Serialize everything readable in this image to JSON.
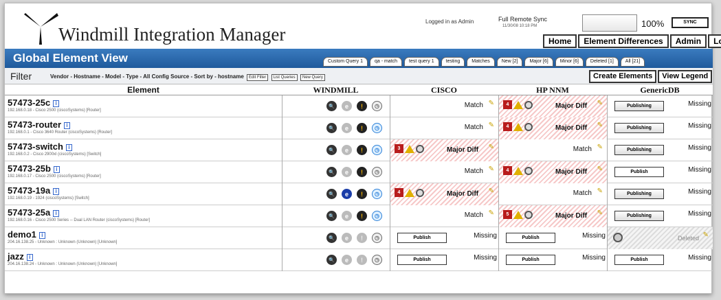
{
  "app": {
    "title": "Windmill Integration Manager"
  },
  "header": {
    "logged_in": "Logged in as Admin",
    "remote_sync": "Full Remote Sync",
    "remote_date": "11/30/08 10:18 PM",
    "percent": "100%",
    "sync_label": "SYNC",
    "nav": [
      "Home",
      "Element Differences",
      "Admin",
      "Logout"
    ]
  },
  "bar": {
    "title": "Global Element View",
    "tabs": [
      "Custom Query 1",
      "qa - match",
      "test query 1",
      "testing",
      "Matches",
      "New [2]",
      "Major [6]",
      "Minor [6]",
      "Deleted [1]",
      "All [21]"
    ]
  },
  "filter": {
    "label": "Filter",
    "text": "Vendor - Hostname - Model - Type - All Config Source - Sort by - hostname",
    "buttons": [
      "Edit Filter",
      "List Queries",
      "New Query"
    ],
    "create": "Create Elements",
    "legend": "View Legend"
  },
  "columns": [
    "Element",
    "WINDMILL",
    "CISCO",
    "HP NNM",
    "GenericDB"
  ],
  "labels": {
    "publish": "Publish",
    "publishing": "Publishing",
    "missing": "Missing",
    "deleted": "Deleted",
    "match": "Match",
    "major_diff": "Major Diff"
  },
  "rows": [
    {
      "name": "57473-25c",
      "desc": "192.168.0.18 - Cisco 2500 (ciscoSystems) [Router]",
      "badge_c": "",
      "badge_h": "4"
    },
    {
      "name": "57473-router",
      "desc": "192.168.0.1 - Cisco 3640 Router (ciscoSystems) [Router]",
      "badge_c": "",
      "badge_h": "4"
    },
    {
      "name": "57473-switch",
      "desc": "192.168.0.2 - Cisco 2900xl (ciscoSystems) [Switch]",
      "badge_c": "3",
      "badge_h": ""
    },
    {
      "name": "57473-25b",
      "desc": "192.168.0.17 - Cisco 2500 (ciscoSystems) [Router]",
      "badge_c": "",
      "badge_h": "4"
    },
    {
      "name": "57473-19a",
      "desc": "192.168.0.19 - 1924 (ciscoSystems) [Switch]",
      "badge_c": "4",
      "badge_h": ""
    },
    {
      "name": "57473-25a",
      "desc": "192.168.0.16 - Cisco 2500 Series -- Dual LAN Router (ciscoSystems) [Router]",
      "badge_c": "",
      "badge_h": "5"
    },
    {
      "name": "demo1",
      "desc": "204.16.138.25 - Unknown : Unknown (Unknown) [Unknown]",
      "badge_c": "",
      "badge_h": ""
    },
    {
      "name": "jazz",
      "desc": "204.16.138.24 - Unknown : Unknown (Unknown) [Unknown]",
      "badge_c": "",
      "badge_h": ""
    }
  ]
}
